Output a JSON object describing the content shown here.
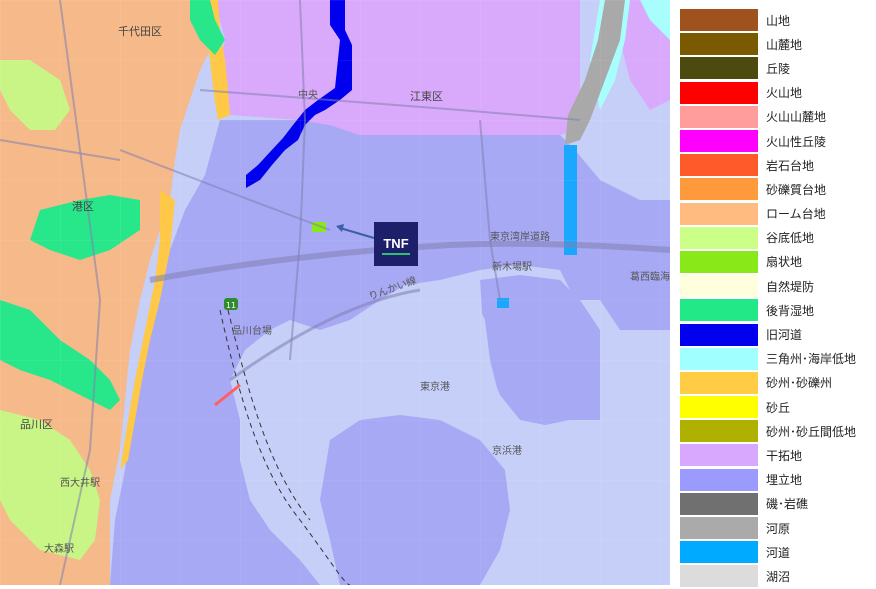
{
  "legend": {
    "items": [
      {
        "label": "山地",
        "color": "#a0521e"
      },
      {
        "label": "山麓地",
        "color": "#7a5a00"
      },
      {
        "label": "丘陵",
        "color": "#4d4a10"
      },
      {
        "label": "火山地",
        "color": "#ff0000"
      },
      {
        "label": "火山山麓地",
        "color": "#ff9c9c"
      },
      {
        "label": "火山性丘陵",
        "color": "#ff00ff"
      },
      {
        "label": "岩石台地",
        "color": "#ff5a2a"
      },
      {
        "label": "砂礫質台地",
        "color": "#ff9a3c"
      },
      {
        "label": "ローム台地",
        "color": "#ffbb80"
      },
      {
        "label": "谷底低地",
        "color": "#ccff88"
      },
      {
        "label": "扇状地",
        "color": "#88e818"
      },
      {
        "label": "自然堤防",
        "color": "#ffffdd"
      },
      {
        "label": "後背湿地",
        "color": "#22e888"
      },
      {
        "label": "旧河道",
        "color": "#0000ee"
      },
      {
        "label": "三角州･海岸低地",
        "color": "#a0ffff"
      },
      {
        "label": "砂州･砂礫州",
        "color": "#ffcc44"
      },
      {
        "label": "砂丘",
        "color": "#ffff00"
      },
      {
        "label": "砂州･砂丘間低地",
        "color": "#b0b000"
      },
      {
        "label": "干拓地",
        "color": "#d8a8ff"
      },
      {
        "label": "埋立地",
        "color": "#9a9aff"
      },
      {
        "label": "磯･岩礁",
        "color": "#707070"
      },
      {
        "label": "河原",
        "color": "#aaaaaa"
      },
      {
        "label": "河道",
        "color": "#00aaff"
      },
      {
        "label": "湖沼",
        "color": "#dcdcdc"
      }
    ]
  },
  "map": {
    "labels": {
      "chiyoda": "千代田区",
      "koto": "江東区",
      "minato": "港区",
      "shinagawa": "品川区",
      "tokyoko": "東京港",
      "keihinko": "京浜港",
      "chuo": "中央",
      "tokyo_bay_road": "東京湾岸道路",
      "shinagawa_daiba": "品川台場",
      "rinkai_line": "りんかい線",
      "kasai_station": "葛西臨海公園駅",
      "oimachi": "大森駅",
      "nishi_oi": "西大井駅",
      "shinkiba": "新木場駅",
      "route": "11"
    },
    "logo": "TNF"
  }
}
